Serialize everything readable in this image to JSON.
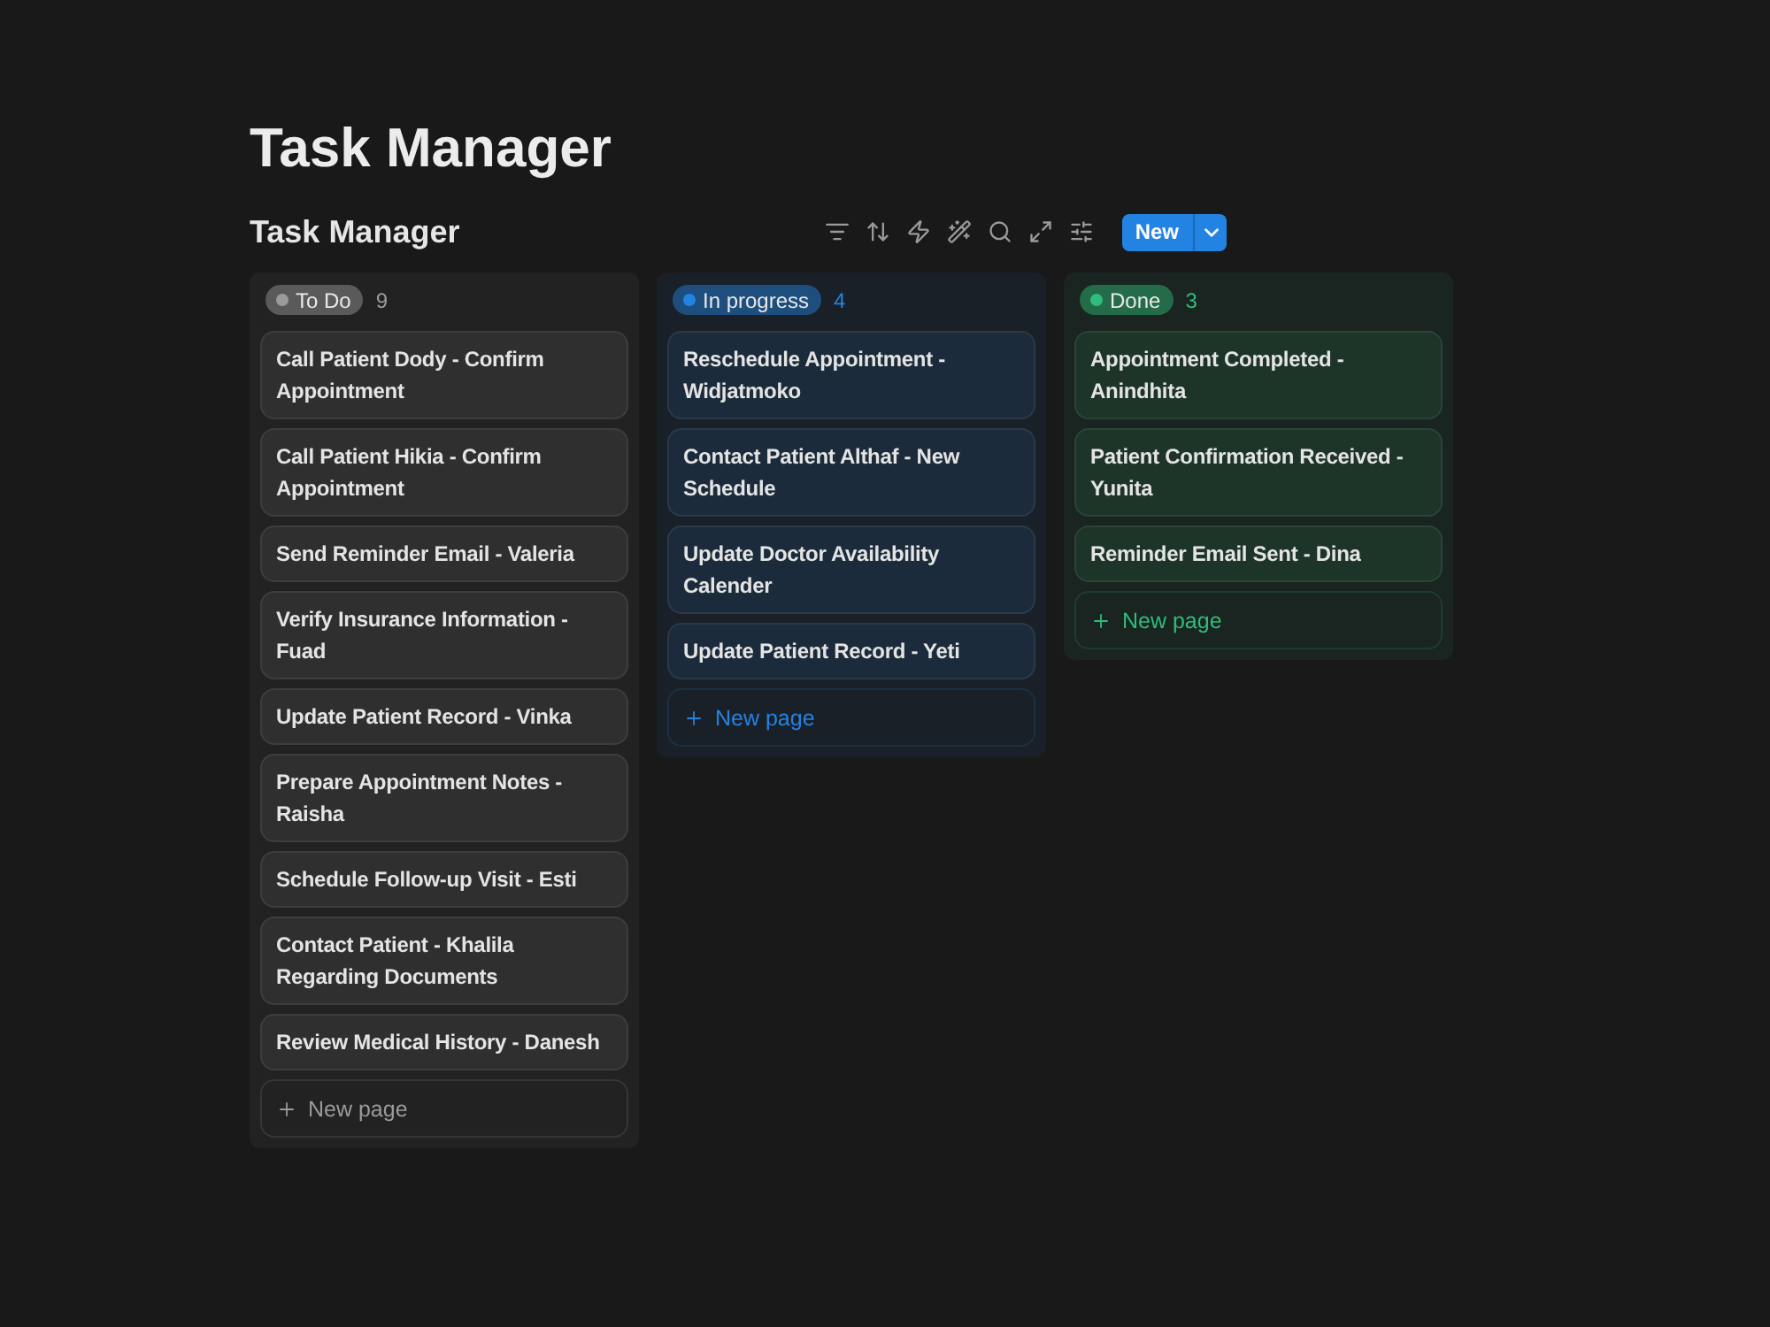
{
  "page_title": "Task Manager",
  "view": {
    "title": "Task Manager",
    "new_button": {
      "label": "New"
    }
  },
  "columns": [
    {
      "status": "To Do",
      "color": "#9b9b9b",
      "count": "9",
      "cards": [
        "Call Patient Dody - Confirm Appointment",
        "Call Patient Hikia - Confirm Appointment",
        "Send Reminder Email - Valeria",
        "Verify Insurance Information - Fuad",
        "Update Patient Record - Vinka",
        "Prepare Appointment Notes - Raisha",
        "Schedule Follow-up Visit - Esti",
        "Contact Patient - Khalila Regarding Documents",
        "Review Medical History - Danesh"
      ],
      "new_page": "New page"
    },
    {
      "status": "In progress",
      "color": "#2383e2",
      "count": "4",
      "cards": [
        "Reschedule Appointment - Widjatmoko",
        "Contact Patient Althaf - New Schedule",
        "Update Doctor Availability Calender",
        "Update Patient Record - Yeti"
      ],
      "new_page": "New page"
    },
    {
      "status": "Done",
      "color": "#2ebd7a",
      "count": "3",
      "cards": [
        "Appointment Completed - Anindhita",
        "Patient Confirmation Received - Yunita",
        "Reminder Email Sent - Dina"
      ],
      "new_page": "New page"
    }
  ]
}
